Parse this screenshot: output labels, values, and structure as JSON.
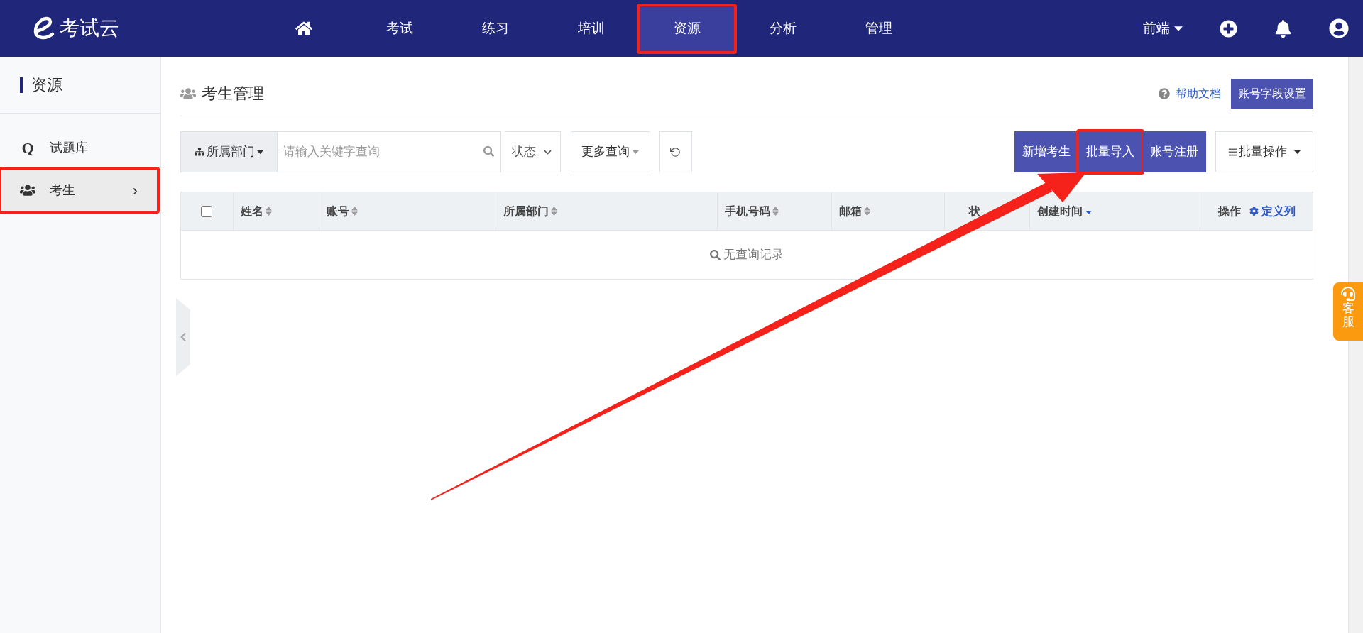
{
  "brand": {
    "name": "考试云"
  },
  "nav": [
    {
      "kind": "home",
      "selected": false,
      "highlighted": false
    },
    {
      "kind": "text",
      "label": "考试",
      "selected": false,
      "highlighted": false
    },
    {
      "kind": "text",
      "label": "练习",
      "selected": false,
      "highlighted": false
    },
    {
      "kind": "text",
      "label": "培训",
      "selected": false,
      "highlighted": false
    },
    {
      "kind": "text",
      "label": "资源",
      "selected": true,
      "highlighted": true
    },
    {
      "kind": "text",
      "label": "分析",
      "selected": false,
      "highlighted": false
    },
    {
      "kind": "text",
      "label": "管理",
      "selected": false,
      "highlighted": false
    }
  ],
  "user_menu": {
    "label": "前端"
  },
  "sidebar": {
    "title": "资源",
    "items": [
      {
        "kind": "bank",
        "icon_char": "Q",
        "label": "试题库",
        "selected": false,
        "highlighted": false
      },
      {
        "kind": "people",
        "label": "考生",
        "chevron": "›",
        "selected": true,
        "highlighted": true
      }
    ]
  },
  "page": {
    "title": "考生管理",
    "help_link": "帮助文档",
    "settings_button": "账号字段设置"
  },
  "filters": {
    "department": "所属部门",
    "search_placeholder": "请输入关键字查询",
    "status": "状态",
    "more": "更多查询"
  },
  "actions": [
    {
      "label": "新增考生",
      "highlighted": false
    },
    {
      "label": "批量导入",
      "highlighted": true
    },
    {
      "label": "账号注册",
      "highlighted": false
    }
  ],
  "batch_menu": {
    "label": "批量操作"
  },
  "table": {
    "select_all_checked": false,
    "columns": [
      {
        "label": "姓名",
        "sortable": true,
        "sorted": false
      },
      {
        "label": "账号",
        "sortable": true,
        "sorted": false
      },
      {
        "label": "所属部门",
        "sortable": true,
        "sorted": false
      },
      {
        "label": "手机号码",
        "sortable": true,
        "sorted": false
      },
      {
        "label": "邮箱",
        "sortable": true,
        "sorted": false
      },
      {
        "label": "状",
        "sortable": false
      },
      {
        "label": "创建时间",
        "sortable": true,
        "sorted": true
      },
      {
        "label": "操作",
        "sortable": false
      }
    ],
    "customize_link": "定义列",
    "empty_text": "无查询记录"
  },
  "service_tab": {
    "label": "客服"
  },
  "annotation_arrow": true
}
